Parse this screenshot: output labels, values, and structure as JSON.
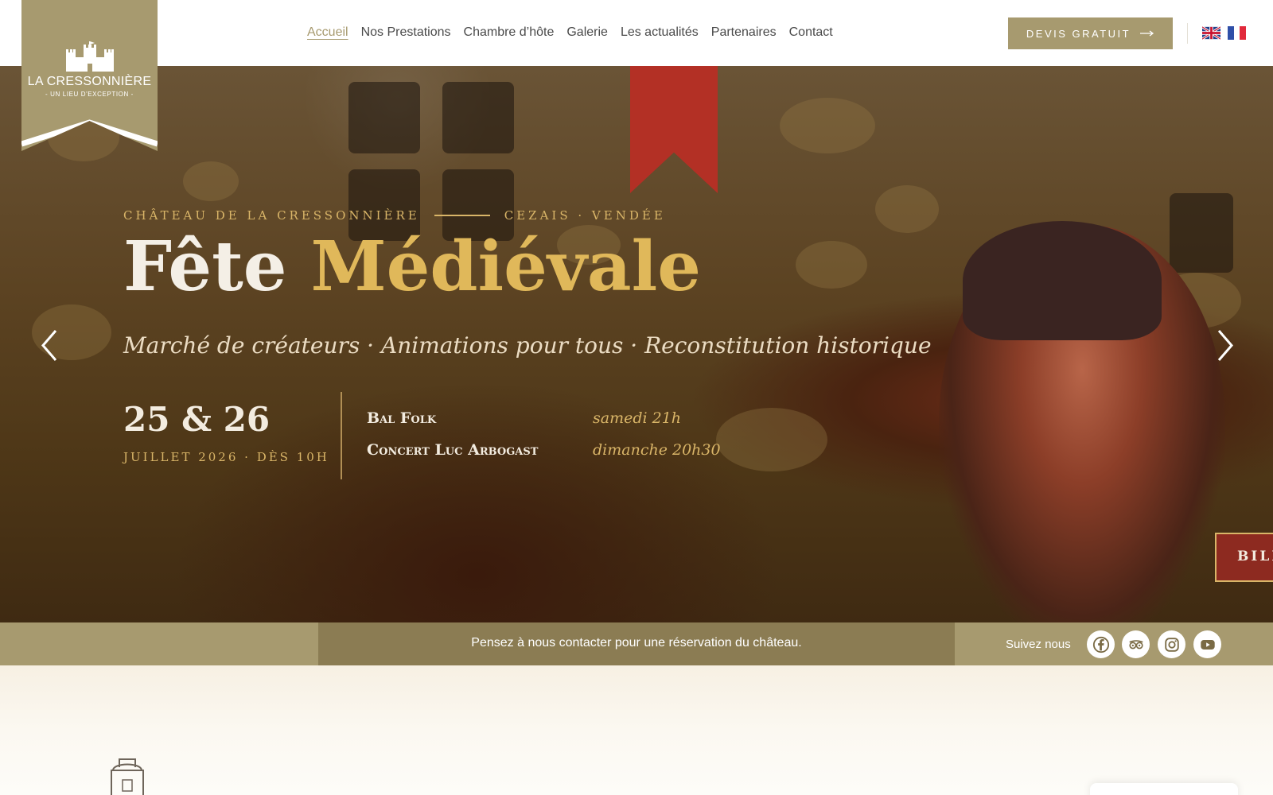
{
  "logo": {
    "name": "LA CRESSONNIÈRE",
    "tagline": "- UN LIEU D'EXCEPTION -"
  },
  "nav": [
    "Accueil",
    "Nos Prestations",
    "Chambre d’hôte",
    "Galerie",
    "Les actualités",
    "Partenaires",
    "Contact"
  ],
  "nav_active": "Accueil",
  "header": {
    "cta_label": "DEVIS GRATUIT"
  },
  "languages": [
    "English",
    "Français"
  ],
  "hero": {
    "kicker_left": "CHÂTEAU DE LA CRESSONNIÈRE",
    "kicker_right": "CEZAIS · VENDÉE",
    "title_part1": "Fête",
    "title_part2": "Médiévale",
    "subtitle": "Marché de créateurs · Animations pour tous · Reconstitution historique",
    "date": "25 & 26",
    "date_sub": "JUILLET 2026 · DÈS 10H",
    "events": [
      {
        "name": "Bal Folk",
        "time": "samedi 21h"
      },
      {
        "name": "Concert Luc Arbogast",
        "time": "dimanche 20h30"
      }
    ],
    "ticket_label": "BILL"
  },
  "infobar": {
    "text": "Pensez à nous contacter pour une réservation du château.",
    "follow_label": "Suivez nous"
  },
  "social": [
    "facebook-icon",
    "tripadvisor-icon",
    "instagram-icon",
    "youtube-icon"
  ],
  "colors": {
    "brand": "#a79a6f",
    "gold": "#e0b85a",
    "hero_red": "#8d2a20"
  }
}
